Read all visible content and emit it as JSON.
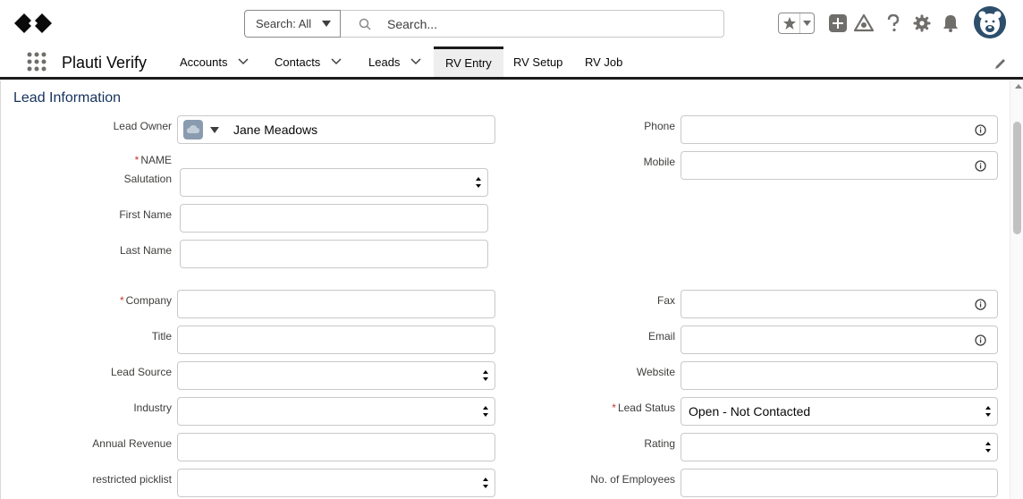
{
  "header": {
    "search_scope_label": "Search: All",
    "search_placeholder": "Search...",
    "icons": [
      "favorites-star-icon",
      "add-icon",
      "trailhead-icon",
      "help-icon",
      "setup-gear-icon",
      "notifications-bell-icon",
      "user-avatar"
    ]
  },
  "nav": {
    "app_name": "Plauti Verify",
    "items": [
      {
        "label": "Accounts",
        "has_menu": true
      },
      {
        "label": "Contacts",
        "has_menu": true
      },
      {
        "label": "Leads",
        "has_menu": true
      },
      {
        "label": "RV Entry",
        "active": true
      },
      {
        "label": "RV Setup"
      },
      {
        "label": "RV Job"
      }
    ]
  },
  "form": {
    "section_title": "Lead Information",
    "left": {
      "lead_owner": {
        "label": "Lead Owner",
        "value": "Jane Meadows"
      },
      "name_heading": "NAME",
      "salutation": {
        "label": "Salutation",
        "value": ""
      },
      "first_name": {
        "label": "First Name",
        "value": ""
      },
      "last_name": {
        "label": "Last Name",
        "value": ""
      },
      "company": {
        "label": "Company",
        "value": "",
        "required": true
      },
      "title": {
        "label": "Title",
        "value": ""
      },
      "lead_source": {
        "label": "Lead Source",
        "value": ""
      },
      "industry": {
        "label": "Industry",
        "value": ""
      },
      "annual_revenue": {
        "label": "Annual Revenue",
        "value": ""
      },
      "restricted_picklist": {
        "label": "restricted picklist",
        "value": ""
      }
    },
    "right": {
      "phone": {
        "label": "Phone",
        "value": ""
      },
      "mobile": {
        "label": "Mobile",
        "value": ""
      },
      "fax": {
        "label": "Fax",
        "value": ""
      },
      "email": {
        "label": "Email",
        "value": ""
      },
      "website": {
        "label": "Website",
        "value": ""
      },
      "lead_status": {
        "label": "Lead Status",
        "value": "Open - Not Contacted",
        "required": true
      },
      "rating": {
        "label": "Rating",
        "value": ""
      },
      "no_of_employees": {
        "label": "No. of Employees",
        "value": ""
      }
    },
    "required_marker": "*"
  },
  "colors": {
    "accent_navy": "#16325c",
    "required_red": "#c23934",
    "active_tab_bg": "#eeeeee"
  }
}
